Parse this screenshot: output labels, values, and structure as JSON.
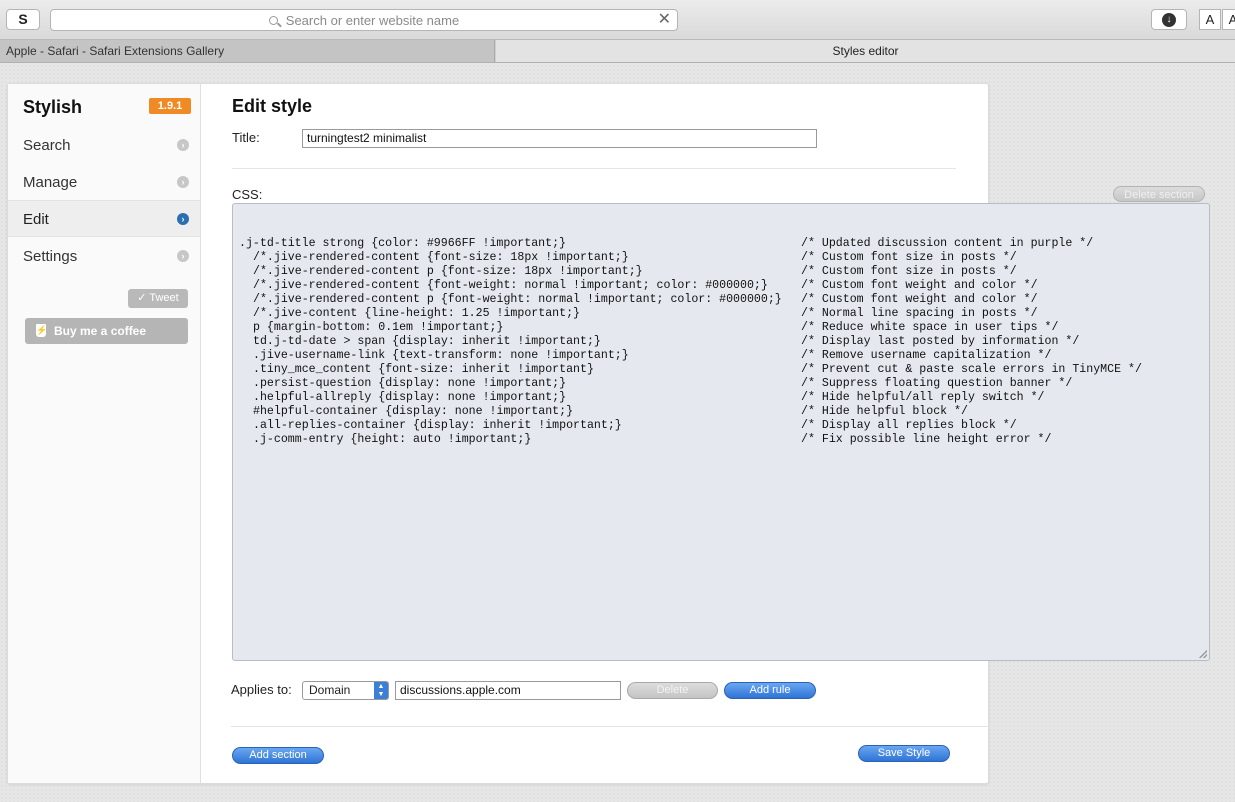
{
  "browser": {
    "s_button": "S",
    "url_placeholder": "Search or enter website name",
    "clear_glyph": "✕",
    "download_glyph": "↓",
    "font_buttons": [
      "A",
      "A"
    ],
    "tabs": [
      {
        "label": "Apple - Safari - Safari Extensions Gallery",
        "active": false
      },
      {
        "label": "Styles editor",
        "active": true
      }
    ]
  },
  "sidebar": {
    "brand": "Stylish",
    "version": "1.9.1",
    "items": [
      {
        "label": "Search",
        "active": false
      },
      {
        "label": "Manage",
        "active": false
      },
      {
        "label": "Edit",
        "active": true
      },
      {
        "label": "Settings",
        "active": false
      }
    ],
    "tweet_label": "Tweet",
    "coffee_label": "Buy me a coffee"
  },
  "editor": {
    "heading": "Edit style",
    "title_label": "Title:",
    "title_value": "turningtest2 minimalist",
    "css_label": "CSS:",
    "delete_section_label": "Delete section",
    "code_lines": [
      {
        "rule": ".j-td-title strong {color: #9966FF !important;}",
        "comment": "/* Updated discussion content in purple */",
        "indent": false
      },
      {
        "rule": "/*.jive-rendered-content {font-size: 18px !important;}",
        "comment": "/* Custom font size in posts */",
        "indent": true
      },
      {
        "rule": "/*.jive-rendered-content p {font-size: 18px !important;}",
        "comment": "/* Custom font size in posts */",
        "indent": true
      },
      {
        "rule": "/*.jive-rendered-content {font-weight: normal !important; color: #000000;}",
        "comment": "/* Custom font weight and color */",
        "indent": true
      },
      {
        "rule": "/*.jive-rendered-content p {font-weight: normal !important; color: #000000;}",
        "comment": "/* Custom font weight and color */",
        "indent": true
      },
      {
        "rule": "/*.jive-content {line-height: 1.25 !important;}",
        "comment": "/* Normal line spacing in posts */",
        "indent": true
      },
      {
        "rule": "p {margin-bottom: 0.1em !important;}",
        "comment": "/* Reduce white space in user tips */",
        "indent": true
      },
      {
        "rule": "td.j-td-date > span {display: inherit !important;}",
        "comment": "/* Display last posted by information */",
        "indent": true
      },
      {
        "rule": ".jive-username-link {text-transform: none !important;}",
        "comment": "/* Remove username capitalization */",
        "indent": true
      },
      {
        "rule": ".tiny_mce_content {font-size: inherit !important}",
        "comment": "/* Prevent cut & paste scale errors in TinyMCE */",
        "indent": true
      },
      {
        "rule": ".persist-question {display: none !important;}",
        "comment": "/* Suppress floating question banner */",
        "indent": true
      },
      {
        "rule": ".helpful-allreply {display: none !important;}",
        "comment": "/* Hide helpful/all reply switch */",
        "indent": true
      },
      {
        "rule": "#helpful-container {display: none !important;}",
        "comment": "/* Hide helpful block */",
        "indent": true
      },
      {
        "rule": ".all-replies-container {display: inherit !important;}",
        "comment": "/* Display all replies block */",
        "indent": true
      },
      {
        "rule": ".j-comm-entry {height: auto !important;}",
        "comment": "/* Fix possible line height error */",
        "indent": true
      }
    ],
    "applies_label": "Applies to:",
    "applies_type": "Domain",
    "applies_value": "discussions.apple.com",
    "delete_label": "Delete",
    "add_rule_label": "Add rule",
    "add_section_label": "Add section",
    "save_label": "Save Style"
  },
  "colors": {
    "version_badge": "#f08a24",
    "accent_blue": "#2f74d6",
    "code_bg": "#e5e9ef"
  }
}
